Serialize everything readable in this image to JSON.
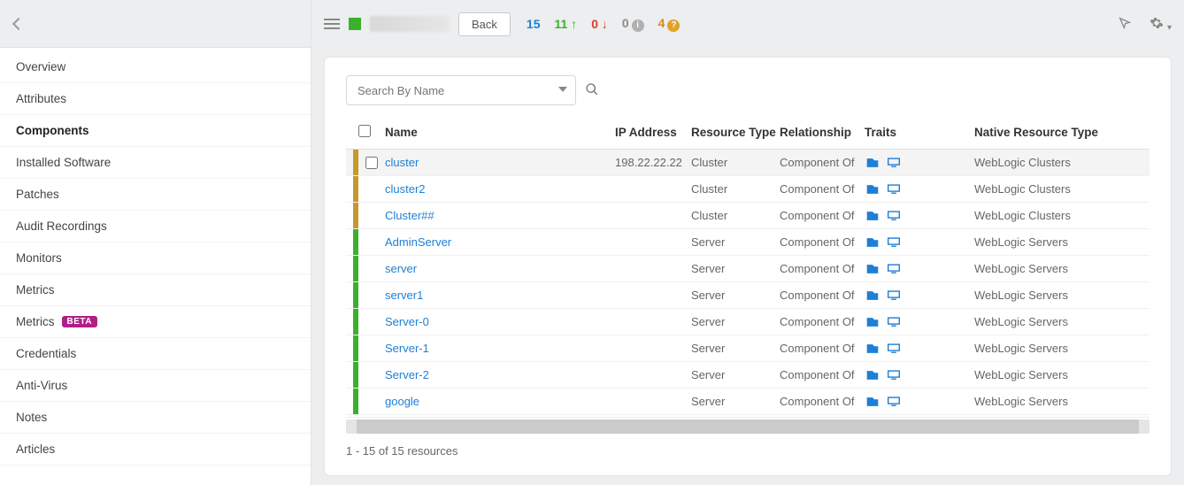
{
  "sidebar": {
    "items": [
      {
        "label": "Overview",
        "active": false,
        "badge": null
      },
      {
        "label": "Attributes",
        "active": false,
        "badge": null
      },
      {
        "label": "Components",
        "active": true,
        "badge": null
      },
      {
        "label": "Installed Software",
        "active": false,
        "badge": null
      },
      {
        "label": "Patches",
        "active": false,
        "badge": null
      },
      {
        "label": "Audit Recordings",
        "active": false,
        "badge": null
      },
      {
        "label": "Monitors",
        "active": false,
        "badge": null
      },
      {
        "label": "Metrics",
        "active": false,
        "badge": null
      },
      {
        "label": "Metrics",
        "active": false,
        "badge": "BETA"
      },
      {
        "label": "Credentials",
        "active": false,
        "badge": null
      },
      {
        "label": "Anti-Virus",
        "active": false,
        "badge": null
      },
      {
        "label": "Notes",
        "active": false,
        "badge": null
      },
      {
        "label": "Articles",
        "active": false,
        "badge": null
      }
    ]
  },
  "topbar": {
    "back_label": "Back",
    "stats": {
      "total": "15",
      "up": "11",
      "down": "0",
      "unknown": "0",
      "warn": "4"
    }
  },
  "search": {
    "placeholder": "Search By Name"
  },
  "columns": {
    "name": "Name",
    "ip": "IP Address",
    "type": "Resource Type",
    "rel": "Relationship",
    "traits": "Traits",
    "native": "Native Resource Type"
  },
  "rows": [
    {
      "edge": "amber",
      "name": "cluster",
      "ip": "198.22.22.22",
      "type": "Cluster",
      "rel": "Component Of",
      "native": "WebLogic Clusters",
      "selected": true
    },
    {
      "edge": "amber",
      "name": "cluster2",
      "ip": "",
      "type": "Cluster",
      "rel": "Component Of",
      "native": "WebLogic Clusters"
    },
    {
      "edge": "amber",
      "name": "Cluster##",
      "ip": "",
      "type": "Cluster",
      "rel": "Component Of",
      "native": "WebLogic Clusters"
    },
    {
      "edge": "green",
      "name": "AdminServer",
      "ip": "",
      "type": "Server",
      "rel": "Component Of",
      "native": "WebLogic Servers"
    },
    {
      "edge": "green",
      "name": "server",
      "ip": "",
      "type": "Server",
      "rel": "Component Of",
      "native": "WebLogic Servers"
    },
    {
      "edge": "green",
      "name": "server1",
      "ip": "",
      "type": "Server",
      "rel": "Component Of",
      "native": "WebLogic Servers"
    },
    {
      "edge": "green",
      "name": "Server-0",
      "ip": "",
      "type": "Server",
      "rel": "Component Of",
      "native": "WebLogic Servers"
    },
    {
      "edge": "green",
      "name": "Server-1",
      "ip": "",
      "type": "Server",
      "rel": "Component Of",
      "native": "WebLogic Servers"
    },
    {
      "edge": "green",
      "name": "Server-2",
      "ip": "",
      "type": "Server",
      "rel": "Component Of",
      "native": "WebLogic Servers"
    },
    {
      "edge": "green",
      "name": "google",
      "ip": "",
      "type": "Server",
      "rel": "Component Of",
      "native": "WebLogic Servers"
    }
  ],
  "footer": "1 - 15 of 15 resources"
}
